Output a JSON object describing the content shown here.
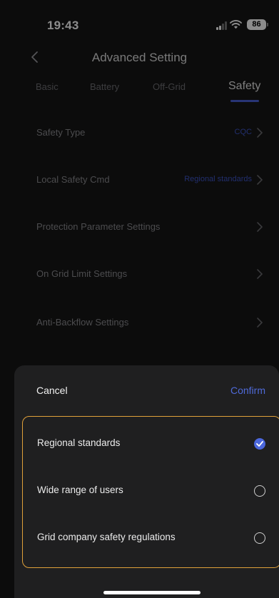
{
  "status_bar": {
    "time": "19:43",
    "battery": "86"
  },
  "nav": {
    "title": "Advanced Setting"
  },
  "tabs": [
    {
      "label": "Basic",
      "active": false
    },
    {
      "label": "Battery",
      "active": false
    },
    {
      "label": "Off-Grid",
      "active": false
    },
    {
      "label": "Safety",
      "active": true
    }
  ],
  "settings": [
    {
      "label": "Safety Type",
      "value": "CQC"
    },
    {
      "label": "Local Safety Cmd",
      "value": "Regional standards"
    },
    {
      "label": "Protection Parameter Settings",
      "value": ""
    },
    {
      "label": "On Grid Limit Settings",
      "value": ""
    },
    {
      "label": "Anti-Backflow Settings",
      "value": ""
    }
  ],
  "sheet": {
    "cancel_label": "Cancel",
    "confirm_label": "Confirm",
    "options": [
      {
        "label": "Regional standards",
        "selected": true
      },
      {
        "label": "Wide range of users",
        "selected": false
      },
      {
        "label": "Grid company safety regulations",
        "selected": false
      }
    ]
  },
  "colors": {
    "accent": "#4b67dc",
    "highlight_border": "#e0a13a",
    "background": "#161617"
  }
}
